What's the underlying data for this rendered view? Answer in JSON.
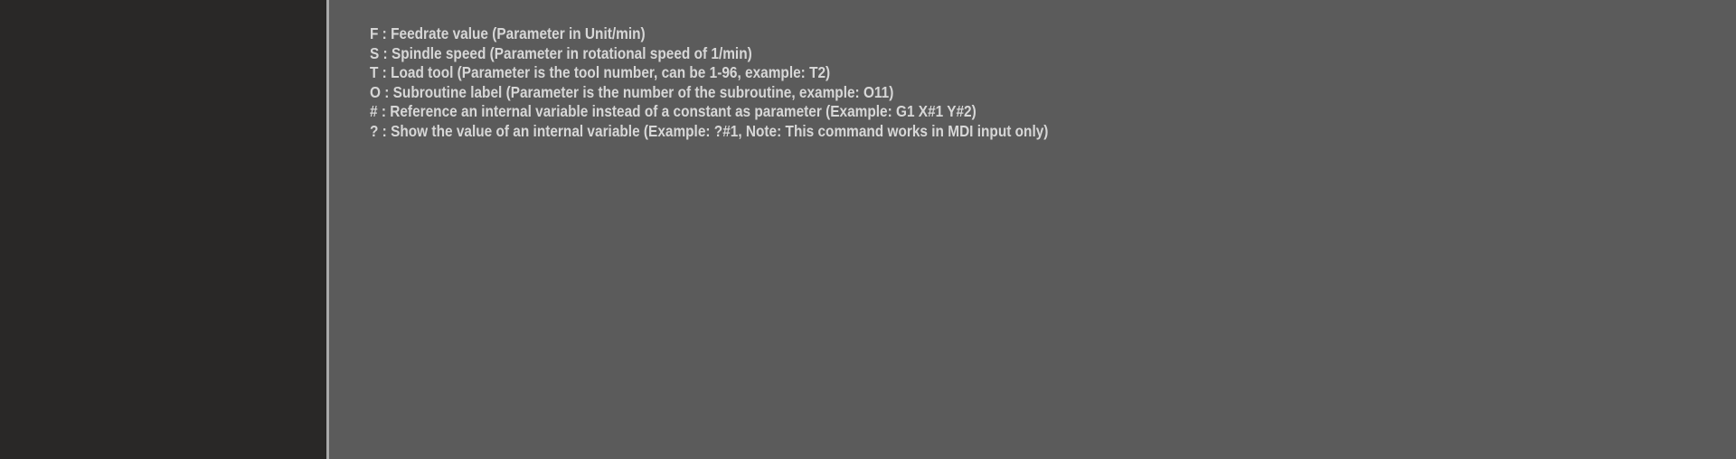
{
  "help": {
    "lines": [
      "F : Feedrate value (Parameter in Unit/min)",
      "S : Spindle speed (Parameter in rotational speed of 1/min)",
      "T : Load tool (Parameter is the tool number, can be 1-96, example: T2)",
      "O : Subroutine label (Parameter is the number of the subroutine, example: O11)",
      "# : Reference an internal variable instead of a constant as parameter (Example: G1 X#1 Y#2)",
      "? : Show the value of an internal variable (Example: ?#1, Note: This command works in MDI input only)"
    ]
  },
  "colors": {
    "sidebar_bg": "#292827",
    "content_bg": "#5b5b5b",
    "divider": "#a9a9a9",
    "text": "#d7d7d7"
  }
}
